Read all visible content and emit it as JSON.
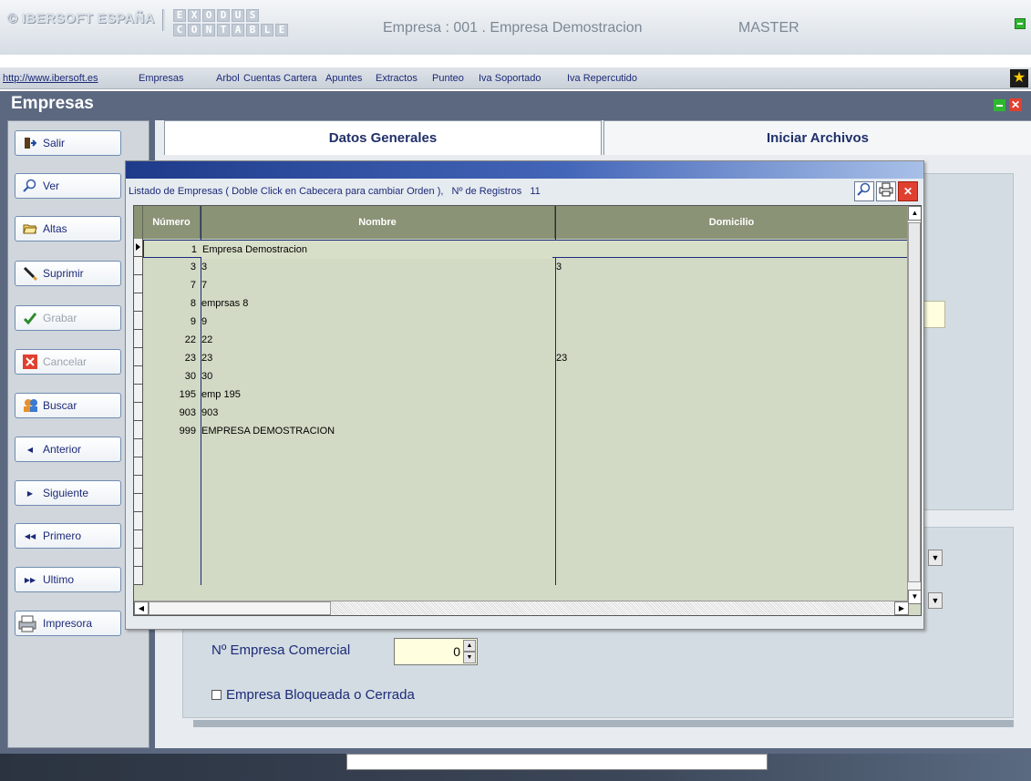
{
  "header": {
    "brand": "© IBERSOFT ESPAÑA",
    "product_line1": [
      "E",
      "X",
      "O",
      "D",
      "U",
      "S"
    ],
    "product_line2": [
      "C",
      "O",
      "N",
      "T",
      "A",
      "B",
      "L",
      "E"
    ],
    "company": "Empresa : 001 . Empresa Demostracion",
    "user": "MASTER"
  },
  "menu": {
    "url": "http://www.ibersoft.es",
    "items": [
      "Empresas",
      "Arbol",
      "Cuentas",
      "Cartera",
      "Apuntes",
      "Extractos",
      "Punteo",
      "Iva Soportado",
      "Iva Repercutido"
    ]
  },
  "window": {
    "title": "Empresas"
  },
  "sidebar": {
    "buttons": [
      {
        "label": "Salir",
        "icon": "exit-icon",
        "enabled": true
      },
      {
        "label": "Ver",
        "icon": "magnifier-icon",
        "enabled": true
      },
      {
        "label": "Altas",
        "icon": "folder-open-icon",
        "enabled": true
      },
      {
        "label": "Suprimir",
        "icon": "pencil-delete-icon",
        "enabled": true
      },
      {
        "label": "Grabar",
        "icon": "checkmark-icon",
        "enabled": false
      },
      {
        "label": "Cancelar",
        "icon": "cancel-x-icon",
        "enabled": false
      },
      {
        "label": "Buscar",
        "icon": "users-search-icon",
        "enabled": true
      },
      {
        "label": "Anterior",
        "icon": "prev-arrow-icon",
        "enabled": true
      },
      {
        "label": "Siguiente",
        "icon": "next-arrow-icon",
        "enabled": true
      },
      {
        "label": "Primero",
        "icon": "first-arrow-icon",
        "enabled": true
      },
      {
        "label": "Ultimo",
        "icon": "last-arrow-icon",
        "enabled": true
      },
      {
        "label": "Impresora",
        "icon": "printer-icon",
        "enabled": true
      }
    ]
  },
  "tabs": [
    "Datos Generales",
    "Iniciar Archivos"
  ],
  "form": {
    "empresa_comercial_label": "Nº Empresa Comercial",
    "empresa_comercial_value": "0",
    "bloqueada_label": "Empresa Bloqueada o Cerrada"
  },
  "dialog": {
    "caption": "Listado de Empresas  ( Doble Click en Cabecera para cambiar Orden ),",
    "count_label": "Nº de Registros",
    "count": "11",
    "columns": [
      "Número",
      "Nombre",
      "Domicilio"
    ],
    "rows": [
      {
        "num": "1",
        "nombre": "Empresa Demostracion",
        "domicilio": ""
      },
      {
        "num": "3",
        "nombre": "3",
        "domicilio": "3"
      },
      {
        "num": "7",
        "nombre": "7",
        "domicilio": ""
      },
      {
        "num": "8",
        "nombre": "emprsas 8",
        "domicilio": ""
      },
      {
        "num": "9",
        "nombre": "9",
        "domicilio": ""
      },
      {
        "num": "22",
        "nombre": "22",
        "domicilio": ""
      },
      {
        "num": "23",
        "nombre": "23",
        "domicilio": "23"
      },
      {
        "num": "30",
        "nombre": "30",
        "domicilio": ""
      },
      {
        "num": "195",
        "nombre": "emp 195",
        "domicilio": ""
      },
      {
        "num": "903",
        "nombre": "903",
        "domicilio": ""
      },
      {
        "num": "999",
        "nombre": "EMPRESA DEMOSTRACION",
        "domicilio": ""
      }
    ]
  }
}
